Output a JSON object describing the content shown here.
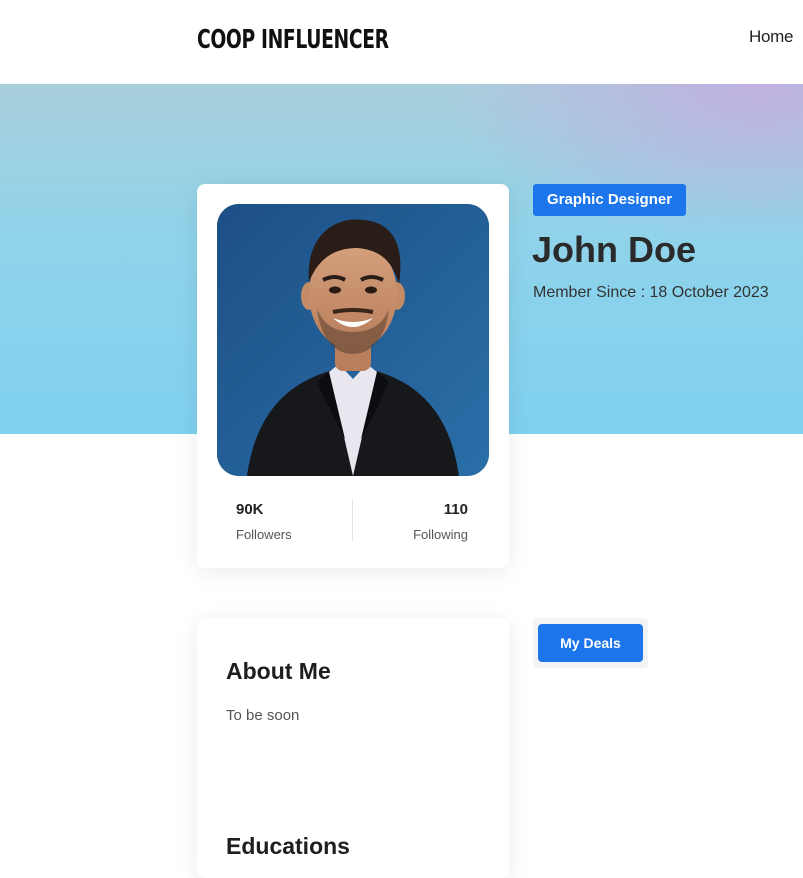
{
  "navbar": {
    "brand": "COOP INFLUENCER",
    "links": [
      {
        "label": "Home"
      }
    ]
  },
  "profile": {
    "role_badge": "Graphic Designer",
    "name": "John Doe",
    "member_since": "Member Since : 18 October 2023",
    "photo_icon": "user-photo",
    "stats": {
      "followers": {
        "value": "90K",
        "label": "Followers"
      },
      "following": {
        "value": "110",
        "label": "Following"
      }
    }
  },
  "about": {
    "title": "About Me",
    "text": "To be soon",
    "educations_title": "Educations"
  },
  "actions": {
    "deals_label": "My Deals"
  },
  "colors": {
    "accent": "#1c75ea",
    "hero_top": "#a9cfdc",
    "hero_bottom": "#7fd0f0",
    "hero_corner": "#c4aae1"
  }
}
